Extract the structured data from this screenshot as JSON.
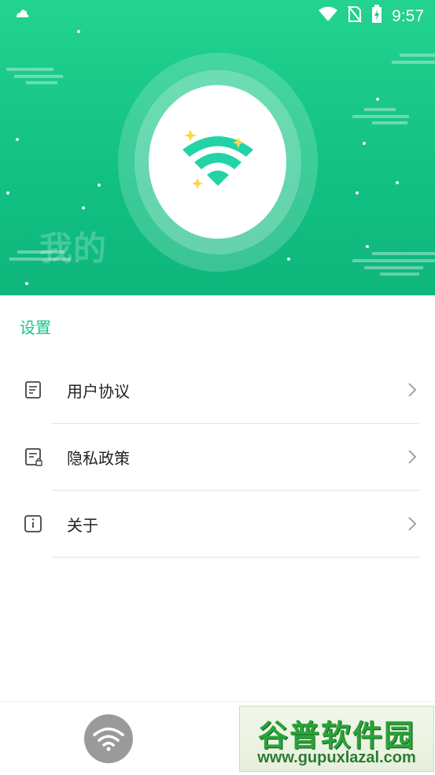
{
  "status_bar": {
    "time": "9:57",
    "icons": [
      "notification-icon",
      "wifi-signal-icon",
      "no-sim-icon",
      "battery-charging-icon"
    ]
  },
  "header": {
    "page_title": "我的",
    "logo_icon": "wifi-sparkle-icon"
  },
  "section": {
    "title": "设置"
  },
  "menu": {
    "items": [
      {
        "label": "用户协议",
        "icon": "document-icon"
      },
      {
        "label": "隐私政策",
        "icon": "privacy-document-icon"
      },
      {
        "label": "关于",
        "icon": "info-icon"
      }
    ]
  },
  "tab_bar": {
    "wifi_tab_icon": "wifi-icon"
  },
  "watermark": {
    "title": "谷普软件园",
    "url": "www.gupuxlazal.com"
  },
  "colors": {
    "primary": "#17c48a",
    "hero_top": "#23d38f",
    "hero_bottom": "#0fb67c",
    "tab_icon_bg": "#9a9a9a"
  }
}
